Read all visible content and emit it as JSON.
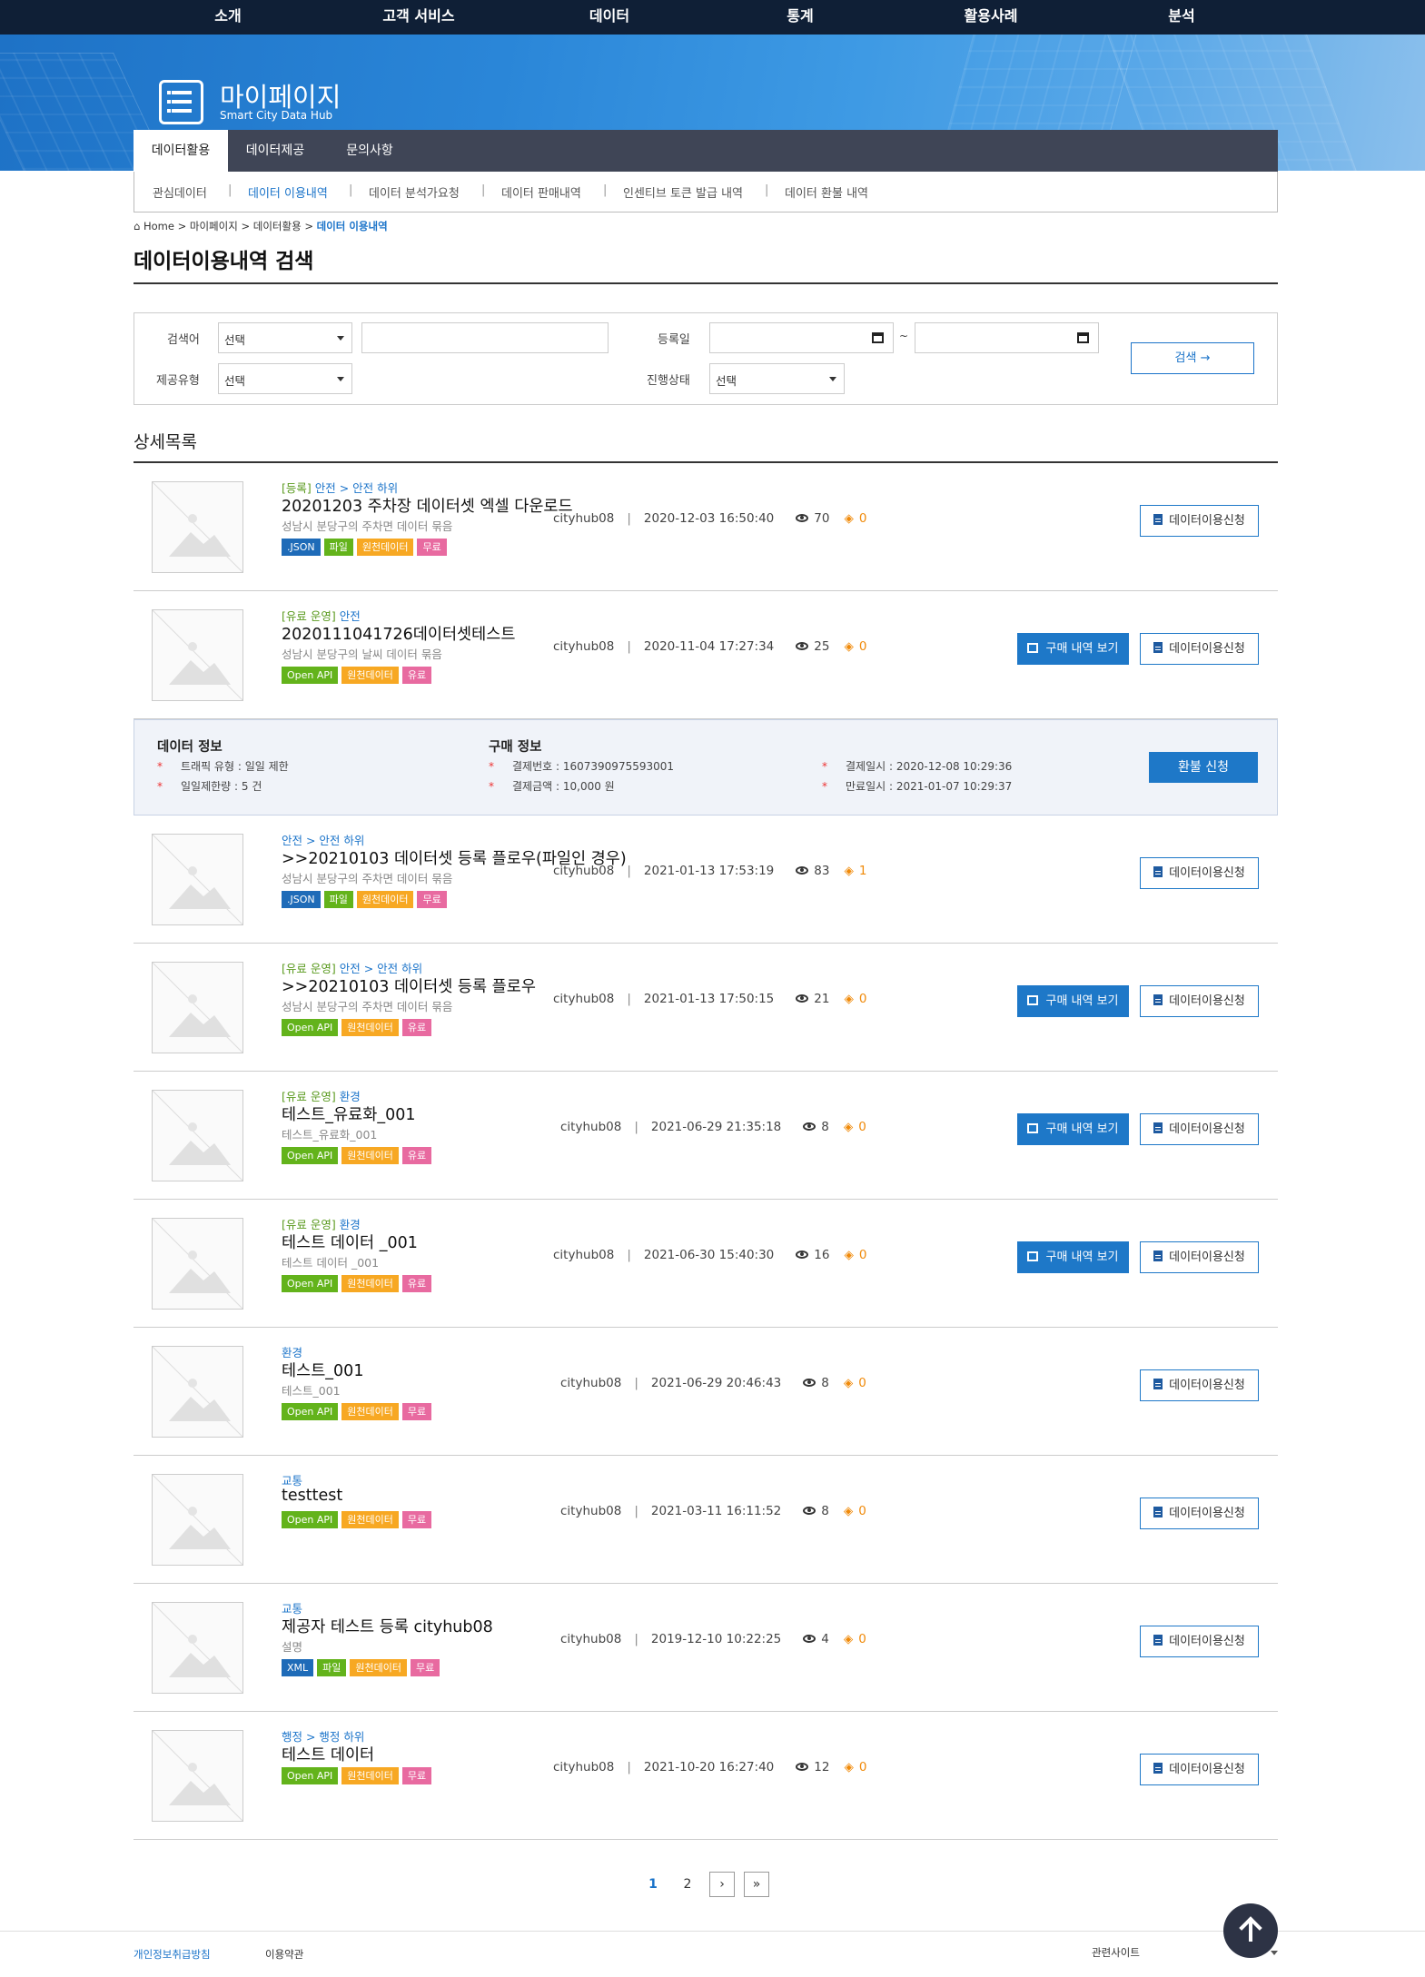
{
  "topnav": [
    "소개",
    "고객 서비스",
    "데이터",
    "통계",
    "활용사례",
    "분석"
  ],
  "hero": {
    "title": "마이페이지",
    "subtitle": "Smart City Data Hub"
  },
  "tabs": [
    "데이터활용",
    "데이터제공",
    "문의사항"
  ],
  "submenu": [
    "관심데이터",
    "데이터 이용내역",
    "데이터 분석가요청",
    "데이터 판매내역",
    "인센티브 토큰 발급 내역",
    "데이터 환불 내역"
  ],
  "breadcrumb": {
    "home": "Home",
    "sep": ">",
    "l1": "마이페이지",
    "l2": "데이터활용",
    "current": "데이터 이용내역"
  },
  "page_title": "데이터이용내역 검색",
  "search": {
    "keyword_label": "검색어",
    "keyword_select": "선택",
    "type_label": "제공유형",
    "type_select": "선택",
    "date_label": "등록일",
    "tilde": "~",
    "status_label": "진행상태",
    "status_select": "선택",
    "button": "검색 →"
  },
  "section_title": "상세목록",
  "labels": {
    "buy": "구매 내역 보기",
    "use": "데이터이용신청"
  },
  "items": [
    {
      "cat_prefix": "[등록]",
      "cat": "안전 > 안전 하위",
      "title": "20201203 주차장 데이터셋 엑셀 다운로드",
      "desc": "성남시 분당구의 주차면 데이터 묶음",
      "tags": [
        ".JSON",
        "파일",
        "원천데이터",
        "무료"
      ],
      "user": "cityhub08",
      "date": "2020-12-03 16:50:40",
      "views": "70",
      "points": "0"
    },
    {
      "cat_prefix": "[유료 운영]",
      "cat": "안전",
      "title": "2020111041726데이터셋테스트",
      "desc": "성남시 분당구의 날씨 데이터 묶음",
      "tags": [
        "Open API",
        "원천데이터",
        "유료"
      ],
      "user": "cityhub08",
      "date": "2020-11-04 17:27:34",
      "views": "25",
      "points": "0"
    },
    {
      "cat_prefix": "",
      "cat": "안전 > 안전 하위",
      "title": ">>20210103 데이터셋 등록 플로우(파일인 경우)",
      "desc": "성남시 분당구의 주차면 데이터 묶음",
      "tags": [
        ".JSON",
        "파일",
        "원천데이터",
        "무료"
      ],
      "user": "cityhub08",
      "date": "2021-01-13 17:53:19",
      "views": "83",
      "points": "1"
    },
    {
      "cat_prefix": "[유료 운영]",
      "cat": "안전 > 안전 하위",
      "title": ">>20210103 데이터셋 등록 플로우",
      "desc": "성남시 분당구의 주차면 데이터 묶음",
      "tags": [
        "Open API",
        "원천데이터",
        "유료"
      ],
      "user": "cityhub08",
      "date": "2021-01-13 17:50:15",
      "views": "21",
      "points": "0"
    },
    {
      "cat_prefix": "[유료 운영]",
      "cat": "환경",
      "title": "테스트_유료화_001",
      "desc": "테스트_유료화_001",
      "tags": [
        "Open API",
        "원천데이터",
        "유료"
      ],
      "user": "cityhub08",
      "date": "2021-06-29 21:35:18",
      "views": "8",
      "points": "0"
    },
    {
      "cat_prefix": "[유료 운영]",
      "cat": "환경",
      "title": "테스트 데이터 _001",
      "desc": "테스트 데이터 _001",
      "tags": [
        "Open API",
        "원천데이터",
        "유료"
      ],
      "user": "cityhub08",
      "date": "2021-06-30 15:40:30",
      "views": "16",
      "points": "0"
    },
    {
      "cat_prefix": "",
      "cat": "환경",
      "title": "테스트_001",
      "desc": "테스트_001",
      "tags": [
        "Open API",
        "원천데이터",
        "무료"
      ],
      "user": "cityhub08",
      "date": "2021-06-29 20:46:43",
      "views": "8",
      "points": "0"
    },
    {
      "cat_prefix": "",
      "cat": "교통",
      "title": "testtest",
      "desc": "",
      "tags": [
        "Open API",
        "원천데이터",
        "무료"
      ],
      "user": "cityhub08",
      "date": "2021-03-11 16:11:52",
      "views": "8",
      "points": "0"
    },
    {
      "cat_prefix": "",
      "cat": "교통",
      "title": "제공자 테스트 등록 cityhub08",
      "desc": "설명",
      "tags": [
        "XML",
        "파일",
        "원천데이터",
        "무료"
      ],
      "user": "cityhub08",
      "date": "2019-12-10 10:22:25",
      "views": "4",
      "points": "0"
    },
    {
      "cat_prefix": "",
      "cat": "행정 > 행정 하위",
      "title": "테스트 데이터",
      "desc": "",
      "tags": [
        "Open API",
        "원천데이터",
        "무료"
      ],
      "user": "cityhub08",
      "date": "2021-10-20 16:27:40",
      "views": "12",
      "points": "0"
    }
  ],
  "info": {
    "data_title": "데이터 정보",
    "purchase_title": "구매 정보",
    "traffic_label": "트래픽 유형 :",
    "traffic_value": "일일 제한",
    "limit_label": "일일제한량 :",
    "limit_value": "5 건",
    "order_label": "결제번호 :",
    "order_value": "1607390975593001",
    "amount_label": "결제금액 :",
    "amount_value": "10,000 원",
    "pay_label": "결제일시 :",
    "pay_value": "2020-12-08 10:29:36",
    "expire_label": "만료일시 :",
    "expire_value": "2021-01-07 10:29:37",
    "refund": "환불 신청"
  },
  "pagination": {
    "pages": [
      "1",
      "2"
    ],
    "current": "1",
    "next": "›",
    "last": "»"
  },
  "footer": {
    "privacy": "개인정보취급방침",
    "terms": "이용약관",
    "related": "관련사이트"
  },
  "colors": {
    "navy": "#0f1f36",
    "accent": "#1a73c9",
    "tab_bar": "#3f4556"
  }
}
